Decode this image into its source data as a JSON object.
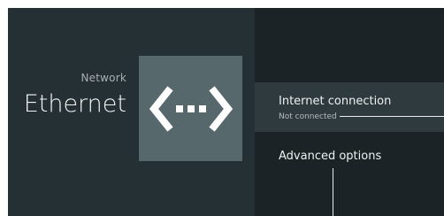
{
  "header": {
    "section_label": "Network",
    "title": "Ethernet"
  },
  "hero": {
    "icon": "ethernet-icon"
  },
  "menu": {
    "items": [
      {
        "title": "Internet connection",
        "subtitle": "Not connected"
      },
      {
        "title": "Advanced options"
      }
    ]
  },
  "colors": {
    "background": "#1f2729",
    "left_pane": "#243033",
    "icon_tile": "#56686c",
    "selected_row": "#2e3a3d",
    "text_primary": "#f1f3f4",
    "text_secondary": "#a9b0b2"
  }
}
